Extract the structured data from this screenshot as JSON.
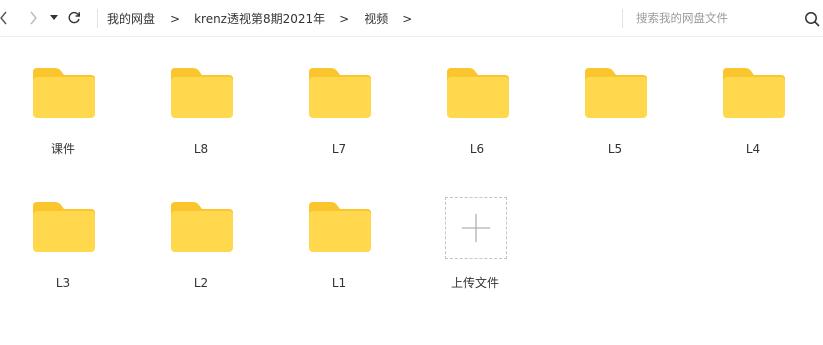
{
  "toolbar": {
    "breadcrumb": [
      "我的网盘",
      "krenz透视第8期2021年",
      "视频"
    ],
    "separator": ">",
    "search_placeholder": "搜索我的网盘文件"
  },
  "icons": {
    "back": "chevron-left-icon",
    "forward": "chevron-right-icon",
    "history": "caret-down-icon",
    "refresh": "refresh-icon",
    "search": "search-icon",
    "folder": "folder-icon",
    "upload": "plus-icon"
  },
  "colors": {
    "folder_body": "#FFD84D",
    "folder_tab": "#FBC52D",
    "text": "#333333",
    "placeholder": "#9A9A9A",
    "dashed_border": "#C4C4C4"
  },
  "items": [
    {
      "name": "课件",
      "type": "folder"
    },
    {
      "name": "L8",
      "type": "folder"
    },
    {
      "name": "L7",
      "type": "folder"
    },
    {
      "name": "L6",
      "type": "folder"
    },
    {
      "name": "L5",
      "type": "folder"
    },
    {
      "name": "L4",
      "type": "folder"
    },
    {
      "name": "L3",
      "type": "folder"
    },
    {
      "name": "L2",
      "type": "folder"
    },
    {
      "name": "L1",
      "type": "folder"
    }
  ],
  "upload": {
    "label": "上传文件"
  }
}
